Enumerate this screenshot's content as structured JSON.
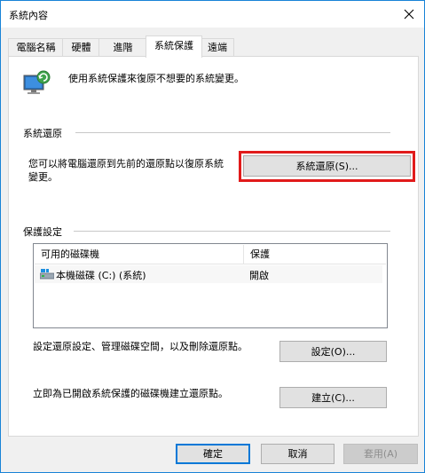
{
  "window": {
    "title": "系統內容"
  },
  "tabs": [
    {
      "label": "電腦名稱"
    },
    {
      "label": "硬體"
    },
    {
      "label": "進階"
    },
    {
      "label": "系統保護"
    },
    {
      "label": "遠端"
    }
  ],
  "header": {
    "description": "使用系統保護來復原不想要的系統變更。"
  },
  "system_restore": {
    "section_title": "系統還原",
    "description_line1": "您可以將電腦還原到先前的還原點以復原系統",
    "description_line2": "變更。",
    "button_label": "系統還原(S)..."
  },
  "protection": {
    "section_title": "保護設定",
    "columns": [
      "可用的磁碟機",
      "保護"
    ],
    "rows": [
      {
        "drive": "本機磁碟 (C:) (系統)",
        "protection": "開啟"
      }
    ],
    "configure_text": "設定還原設定、管理磁碟空間，以及刪除還原點。",
    "configure_button": "設定(O)...",
    "create_text": "立即為已開啟系統保護的磁碟機建立還原點。",
    "create_button": "建立(C)..."
  },
  "footer": {
    "ok": "確定",
    "cancel": "取消",
    "apply": "套用(A)"
  }
}
